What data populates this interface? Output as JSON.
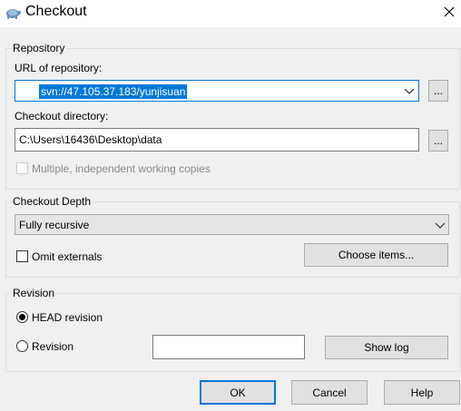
{
  "window": {
    "title": "Checkout",
    "close_glyph": "✕",
    "icon": "tortoise-icon"
  },
  "repository": {
    "legend": "Repository",
    "url_label": "URL of repository:",
    "url_value": "svn://47.105.37.183/yunjisuan",
    "dir_label": "Checkout directory:",
    "dir_value": "C:\\Users\\16436\\Desktop\\data",
    "browse_label": "...",
    "multi_label": "Multiple, independent working copies"
  },
  "depth": {
    "legend": "Checkout Depth",
    "selected": "Fully recursive",
    "omit_label": "Omit externals",
    "choose_label": "Choose items..."
  },
  "revision": {
    "legend": "Revision",
    "head_label": "HEAD revision",
    "rev_label": "Revision",
    "rev_value": "",
    "showlog_label": "Show log",
    "selected_option": "HEAD revision"
  },
  "footer": {
    "ok_label": "OK",
    "cancel_label": "Cancel",
    "help_label": "Help"
  }
}
